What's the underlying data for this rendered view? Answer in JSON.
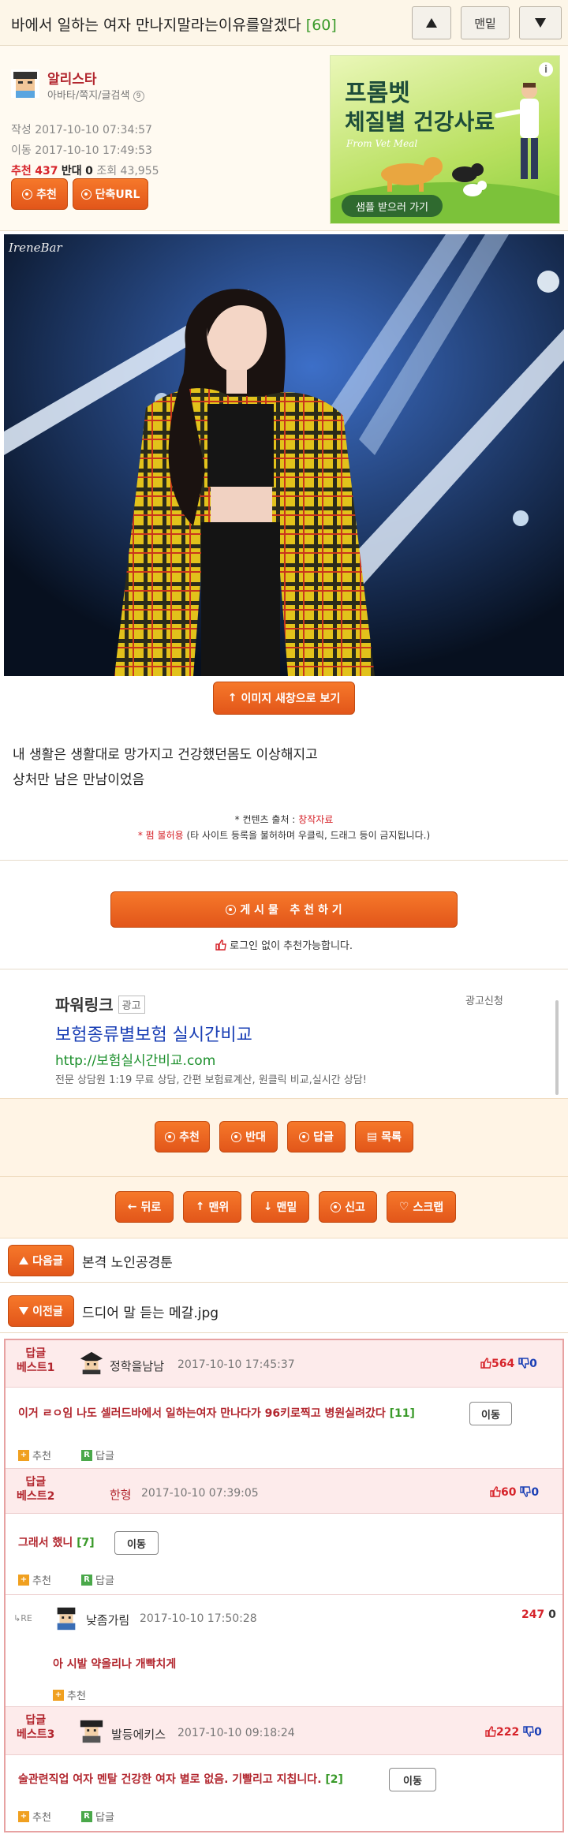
{
  "topbar": {
    "title": "바에서 일하는 여자 만나지말라는이유를알겠다",
    "comment_count": "[60]",
    "bottom_label": "맨밑"
  },
  "post": {
    "author": "알리스타",
    "author_links": "아바타/쪽지/글검색",
    "written_label": "작성 2017-10-10 07:34:57",
    "edited_label": "이동 2017-10-10 17:49:53",
    "rec_label": "추천",
    "rec_count": "437",
    "opp_label": "반대",
    "opp_count": "0",
    "views_label": "조회",
    "views_count": "43,955",
    "btn_recommend": "추천",
    "btn_short_url": "단축URL",
    "photo_watermark": "IreneBar",
    "view_new_window": "이미지 새창으로 보기",
    "body_line1": "내 생활은 생활대로 망가지고 건강했던몸도 이상해지고",
    "body_line2": "상처만 남은 만남이었음",
    "source_prefix": "* 컨텐츠 출처 : ",
    "source_value": "창작자료",
    "source_permission_hl": "펌 불허용",
    "source_permission_rest": " (타 사이트 등록을 불허하며 우클릭, 드래그 등이 금지됩니다.)",
    "big_recommend": "게 시 물   추 천 하 기",
    "no_login_note": "로그인 없이 추천가능합니다."
  },
  "ad": {
    "headline1": "프롬벳",
    "headline2": "체질별 건강사료",
    "script": "From Vet Meal",
    "cta": "샘플 받으러 가기",
    "info": "i"
  },
  "powerlink": {
    "title": "파워링크",
    "badge": "광고",
    "apply": "광고신청",
    "headline": "보험종류별보험 실시간비교",
    "url": "http://보험실시간비교.com",
    "desc": "전문 상담원 1:19 무료 상담, 간편 보험료계산, 원클릭 비교,실시간 상담!"
  },
  "actions1": [
    "추천",
    "반대",
    "답글",
    "목록"
  ],
  "actions2": [
    "뒤로",
    "맨위",
    "맨밑",
    "신고",
    "스크랩"
  ],
  "next_post": {
    "label": "다음글",
    "title": "본격 노인공경툰"
  },
  "prev_post": {
    "label": "이전글",
    "title": "드디어 말 듣는 메갈.jpg"
  },
  "comments": {
    "reply_label": "답글",
    "rec_label": "추천",
    "move_label": "이동",
    "best1": {
      "tag1": "답글",
      "tag2": "베스트1",
      "nick": "정학을남남",
      "date": "2017-10-10 17:45:37",
      "up": "564",
      "down": "0",
      "text": "이거 ㄹㅇ임 나도 셀러드바에서 일하는여자 만나다가 96키로찍고 병원실려갔다",
      "count": "[11]"
    },
    "best2": {
      "tag1": "답글",
      "tag2": "베스트2",
      "nick": "한형",
      "date": "2017-10-10 07:39:05",
      "up": "60",
      "down": "0",
      "text": "그래서 했니",
      "count": "[7]"
    },
    "reply1": {
      "re": "RE",
      "nick": "낮좀가림",
      "date": "2017-10-10 17:50:28",
      "up": "247",
      "down": "0",
      "text": "아 시발 약올리나 개빡치게"
    },
    "best3": {
      "tag1": "답글",
      "tag2": "베스트3",
      "nick": "발등에키스",
      "date": "2017-10-10 09:18:24",
      "up": "222",
      "down": "0",
      "text": "술관련직업 여자 멘탈 건강한 여자 별로 없음. 기빨리고 지칩니다.",
      "count": "[2]"
    }
  },
  "colors": {
    "accent": "#e8621e",
    "best_red": "#b2262e",
    "count_green": "#3a9a2a"
  }
}
